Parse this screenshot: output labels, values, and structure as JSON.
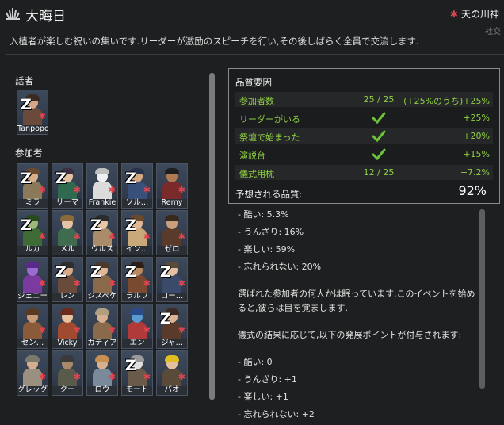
{
  "window": {
    "title": "大晦日",
    "ideoligion": "天の川神",
    "ideoligion_sub": "社交",
    "description": "入植者が楽しむ祝いの集いです.リーダーが激励のスピーチを行い,その後しばらく全員で交流します."
  },
  "speaker_section": {
    "label": "話者",
    "pawn": {
      "name": "Tanpopo",
      "asleep": true
    }
  },
  "participants_section": {
    "label": "参加者",
    "pawns": [
      {
        "name": "ミラ",
        "asleep": true
      },
      {
        "name": "リーマ",
        "asleep": true
      },
      {
        "name": "Frankie",
        "asleep": false
      },
      {
        "name": "ソル…",
        "asleep": true
      },
      {
        "name": "Remy",
        "asleep": false
      },
      {
        "name": "ルカ",
        "asleep": true
      },
      {
        "name": "メル",
        "asleep": false
      },
      {
        "name": "ウルス",
        "asleep": true
      },
      {
        "name": "イン…",
        "asleep": true
      },
      {
        "name": "ゼロ",
        "asleep": false
      },
      {
        "name": "ジェニー",
        "asleep": false
      },
      {
        "name": "レン",
        "asleep": true
      },
      {
        "name": "ジスペケ",
        "asleep": true
      },
      {
        "name": "ラルフ",
        "asleep": true
      },
      {
        "name": "ロー…",
        "asleep": true
      },
      {
        "name": "セン…",
        "asleep": false
      },
      {
        "name": "Vicky",
        "asleep": false
      },
      {
        "name": "カティア",
        "asleep": false
      },
      {
        "name": "エン",
        "asleep": false
      },
      {
        "name": "ジャ…",
        "asleep": true
      },
      {
        "name": "グレッグ",
        "asleep": false
      },
      {
        "name": "クー",
        "asleep": false
      },
      {
        "name": "ロウ",
        "asleep": false
      },
      {
        "name": "モート",
        "asleep": true
      },
      {
        "name": "バオ",
        "asleep": false
      }
    ]
  },
  "quality_tooltip": {
    "title": "品質要因",
    "rows": [
      {
        "label": "参加者数",
        "mid": "25 / 25",
        "value": "(+25%のうち)+25%",
        "check": false
      },
      {
        "label": "リーダーがいる",
        "mid": "",
        "value": "+25%",
        "check": true
      },
      {
        "label": "祭壇で始まった",
        "mid": "",
        "value": "+20%",
        "check": true
      },
      {
        "label": "演説台",
        "mid": "",
        "value": "+15%",
        "check": true
      },
      {
        "label": "儀式用枕",
        "mid": "12 / 25",
        "value": "+7.2%",
        "check": false
      }
    ],
    "expected_label": "予想される品質:",
    "expected_value": "92%",
    "colors": {
      "positive": "#8fcf43",
      "check": "#6cc23a"
    }
  },
  "outcome_report": {
    "chances": [
      "- 酷い: 5.3%",
      "- うんざり: 16%",
      "- 楽しい: 59%",
      "- 忘れられない: 20%"
    ],
    "sleep_note_1": "選ばれた参加者の何人かは眠っています.このイベントを始め",
    "sleep_note_2": "ると,彼らは目を覚まします.",
    "points_header": "儀式の結果に応じて,以下の発展ポイントが付与されます:",
    "points": [
      "- 酷い: 0",
      "- うんざり: +1",
      "- 楽しい: +1",
      "- 忘れられない: +2"
    ]
  }
}
